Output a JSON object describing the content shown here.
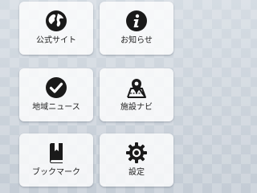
{
  "menu": {
    "tiles": [
      {
        "label": "公式サイト",
        "icon": "globe-icon"
      },
      {
        "label": "お知らせ",
        "icon": "info-icon"
      },
      {
        "label": "地域ニュース",
        "icon": "check-circle-icon"
      },
      {
        "label": "施設ナビ",
        "icon": "map-pin-icon"
      },
      {
        "label": "ブックマーク",
        "icon": "bookmark-book-icon"
      },
      {
        "label": "設定",
        "icon": "gear-icon"
      }
    ]
  },
  "colors": {
    "icon": "#1a1a1a",
    "tile_bg": "#ffffff",
    "page_bg": "#c9d1da"
  }
}
